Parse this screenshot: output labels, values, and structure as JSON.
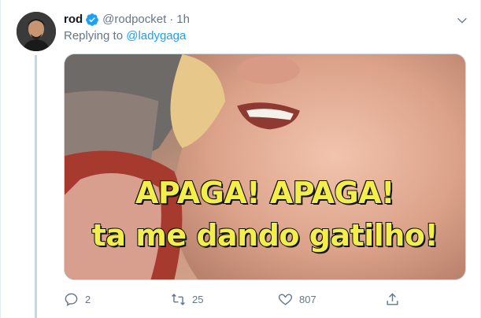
{
  "tweet": {
    "author_name": "rod",
    "handle": "@rodpocket",
    "separator": "·",
    "time": "1h",
    "replying_prefix": "Replying to",
    "replying_to": "@ladygaga"
  },
  "media": {
    "caption_line1": "APAGA! APAGA!",
    "caption_line2": "ta me dando gatilho!"
  },
  "actions": {
    "reply_count": "2",
    "retweet_count": "25",
    "like_count": "807"
  },
  "colors": {
    "accent": "#1da1f2",
    "muted": "#657786",
    "caption": "#f2ee4a"
  },
  "icons": [
    "verified-badge-icon",
    "chevron-down-icon",
    "reply-icon",
    "retweet-icon",
    "like-icon",
    "share-icon"
  ]
}
